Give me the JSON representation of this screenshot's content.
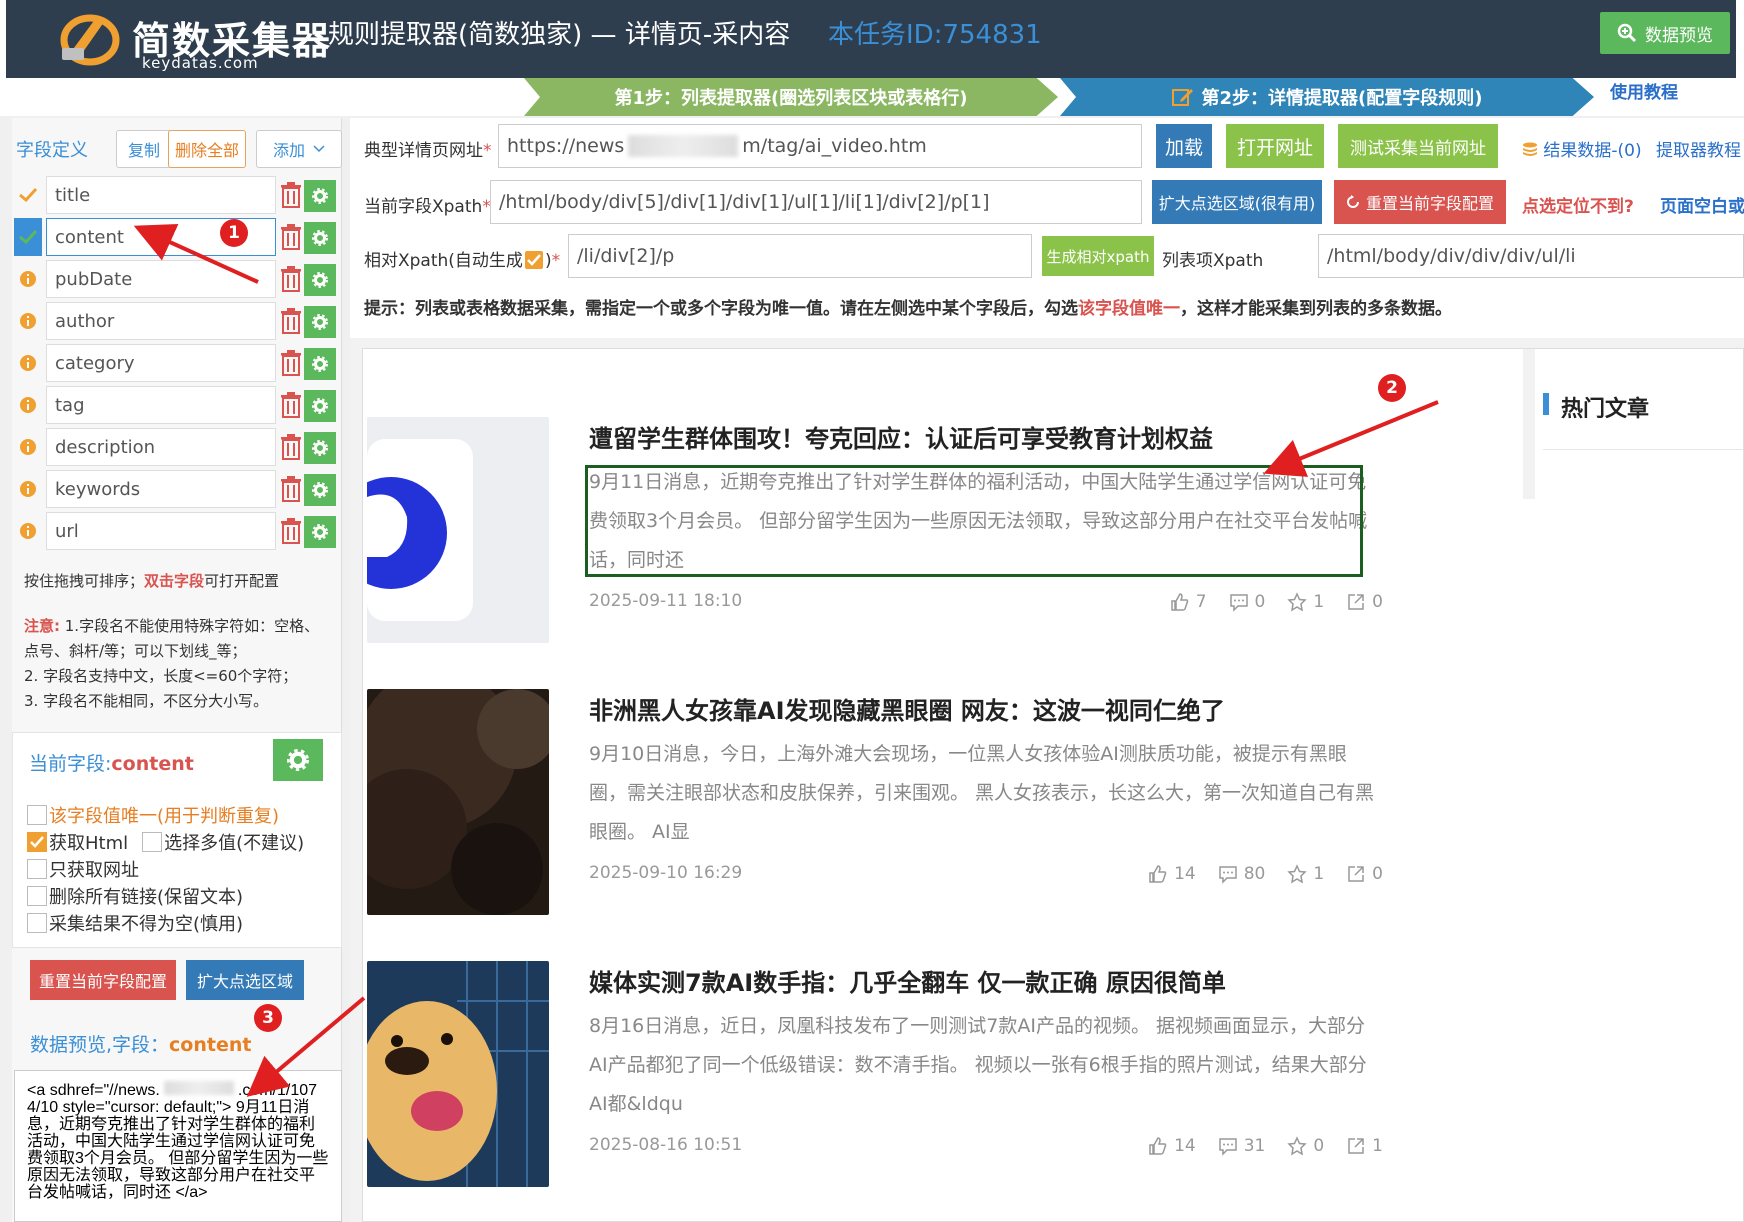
{
  "header": {
    "logo_text": "简数采集器",
    "logo_domain": "keydatas.com",
    "title": "规则提取器(简数独家) — 详情页-采内容",
    "task_id": "本任务ID:754831",
    "preview_button": "数据预览"
  },
  "steps": {
    "step1": "第1步：列表提取器(圈选列表区块或表格行)",
    "step2": "第2步：详情提取器(配置字段规则)",
    "tutorial": "使用教程"
  },
  "fields_panel": {
    "label": "字段定义",
    "copy": "复制",
    "delete_all": "删除全部",
    "add": "添加",
    "fields": [
      {
        "name": "title",
        "status": "check"
      },
      {
        "name": "content",
        "status": "check-active"
      },
      {
        "name": "pubDate",
        "status": "info"
      },
      {
        "name": "author",
        "status": "info"
      },
      {
        "name": "category",
        "status": "info"
      },
      {
        "name": "tag",
        "status": "info"
      },
      {
        "name": "description",
        "status": "info"
      },
      {
        "name": "keywords",
        "status": "info"
      },
      {
        "name": "url",
        "status": "info"
      }
    ],
    "drag_hint_a": "按住拖拽可排序；",
    "drag_hint_b": "双击字段",
    "drag_hint_c": "可打开配置",
    "note_label": "注意:",
    "note_1": " 1.字段名不能使用特殊字符如：空格、点号、斜杆/等；可以下划线_等；",
    "note_2": "2. 字段名支持中文，长度<=60个字符；",
    "note_3": "3. 字段名不能相同，不区分大小写。"
  },
  "current_field": {
    "label": "当前字段:",
    "name": "content",
    "opt_unique": "该字段值唯一(用于判断重复)",
    "opt_html": "获取Html",
    "opt_multi": "选择多值(不建议)",
    "opt_url_only": "只获取网址",
    "opt_strip_links": "删除所有链接(保留文本)",
    "opt_not_empty": "采集结果不得为空(慎用)",
    "reset_btn": "重置当前字段配置",
    "expand_btn": "扩大点选区域"
  },
  "data_preview": {
    "label": "数据预览,字段：",
    "field": "content",
    "content_a": "<a sdhref=\"//news.",
    "content_b": ".com/1/1074/10",
    "content_c": "style=\"cursor: default;\"> 9月11日消息，近期夸克推出了针对学生群体的福利活动，中国大陆学生通过学信网认证可免费领取3个月会员。 但部分留学生因为一些原因无法领取，导致这部分用户在社交平台发帖喊话，同时还 </a>"
  },
  "form": {
    "url_label": "典型详情页网址",
    "url_a": "https://news",
    "url_b": "m/tag/ai_video.htm",
    "load_btn": "加载",
    "open_btn": "打开网址",
    "test_btn": "测试采集当前网址",
    "result_link": "结果数据-(0)",
    "extractor_tutorial": "提取器教程",
    "xpath_label": "当前字段Xpath",
    "xpath_value": "/html/body/div[5]/div[1]/div[1]/ul[1]/li[1]/div[2]/p[1]",
    "expand_btn": "扩大点选区域(很有用)",
    "reset_btn": "重置当前字段配置",
    "cant_locate": "点选定位不到?",
    "blank_page": "页面空白或",
    "rel_label": "相对Xpath(自动生成",
    "rel_value": "/li/div[2]/p",
    "gen_rel_btn": "生成相对xpath",
    "list_label": "列表项Xpath",
    "list_value": "/html/body/div/div/div/ul/li",
    "hint_a": "提示：列表或表格数据采集，需指定一个或多个字段为唯一值。请在左侧选中某个字段后，勾选",
    "hint_b": "该字段值唯一",
    "hint_c": "，这样才能采集到列表的多条数据。"
  },
  "articles": [
    {
      "title": "遭留学生群体围攻！夸克回应：认证后可享受教育计划权益",
      "summary": "9月11日消息，近期夸克推出了针对学生群体的福利活动，中国大陆学生通过学信网认证可免费领取3个月会员。 但部分留学生因为一些原因无法领取，导致这部分用户在社交平台发帖喊话，同时还",
      "date": "2025-09-11 18:10",
      "likes": "7",
      "comments": "0",
      "stars": "1",
      "shares": "0"
    },
    {
      "title": "非洲黑人女孩靠AI发现隐藏黑眼圈 网友：这波一视同仁绝了",
      "summary": "9月10日消息，今日，上海外滩大会现场，一位黑人女孩体验AI测肤质功能，被提示有黑眼圈，需关注眼部状态和皮肤保养，引来围观。 黑人女孩表示，长这么大，第一次知道自己有黑眼圈。 AI显",
      "date": "2025-09-10 16:29",
      "likes": "14",
      "comments": "80",
      "stars": "1",
      "shares": "0"
    },
    {
      "title": "媒体实测7款AI数手指：几乎全翻车 仅一款正确 原因很简单",
      "summary": "8月16日消息，近日，凤凰科技发布了一则测试7款AI产品的视频。 据视频画面显示，大部分AI产品都犯了同一个低级错误：数不清手指。 视频以一张有6根手指的照片测试，结果大部分AI都&ldqu",
      "date": "2025-08-16 10:51",
      "likes": "14",
      "comments": "31",
      "stars": "0",
      "shares": "1"
    }
  ],
  "sidebar": {
    "hot_title": "热门文章"
  },
  "annotations": {
    "b1": "1",
    "b2": "2",
    "b3": "3"
  },
  "colors": {
    "header_bg": "#2e3e4e",
    "green": "#5cb85c",
    "blue": "#337ab7",
    "red": "#d9534f",
    "selection": "#1b5e20"
  }
}
